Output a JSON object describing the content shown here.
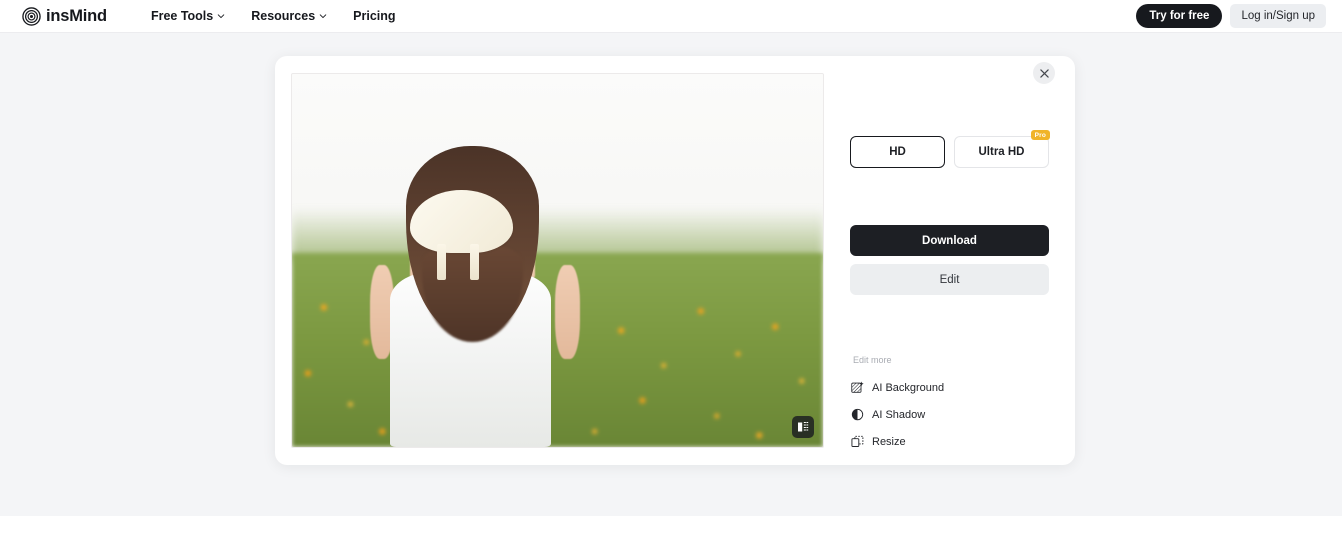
{
  "header": {
    "brand": {
      "name": "insMind",
      "logo_icon": "concentric-circles-logo"
    },
    "nav": [
      {
        "label": "Free Tools",
        "has_chevron": true
      },
      {
        "label": "Resources",
        "has_chevron": true
      },
      {
        "label": "Pricing",
        "has_chevron": false
      }
    ],
    "try_free_label": "Try for free",
    "login_label": "Log in/Sign up"
  },
  "modal": {
    "close_icon": "close-x-icon",
    "preview": {
      "compare_icon": "compare-split-icon",
      "alt": "Woman seen from behind with a white bow in long brown hair, wearing a white dress, standing in a field of orange cosmos flowers"
    },
    "quality": {
      "options": [
        {
          "label": "HD",
          "selected": true,
          "badge": null
        },
        {
          "label": "Ultra HD",
          "selected": false,
          "badge": "Pro"
        }
      ]
    },
    "download_label": "Download",
    "edit_label": "Edit",
    "edit_more": {
      "title": "Edit more",
      "items": [
        {
          "label": "AI Background",
          "icon": "ai-background-icon"
        },
        {
          "label": "AI Shadow",
          "icon": "ai-shadow-icon"
        },
        {
          "label": "Resize",
          "icon": "resize-icon"
        }
      ]
    }
  },
  "colors": {
    "accent_dark": "#1d1f24",
    "badge_gold": "#f0b429",
    "stage_grey": "#f4f5f7",
    "button_grey": "#eceef0"
  }
}
